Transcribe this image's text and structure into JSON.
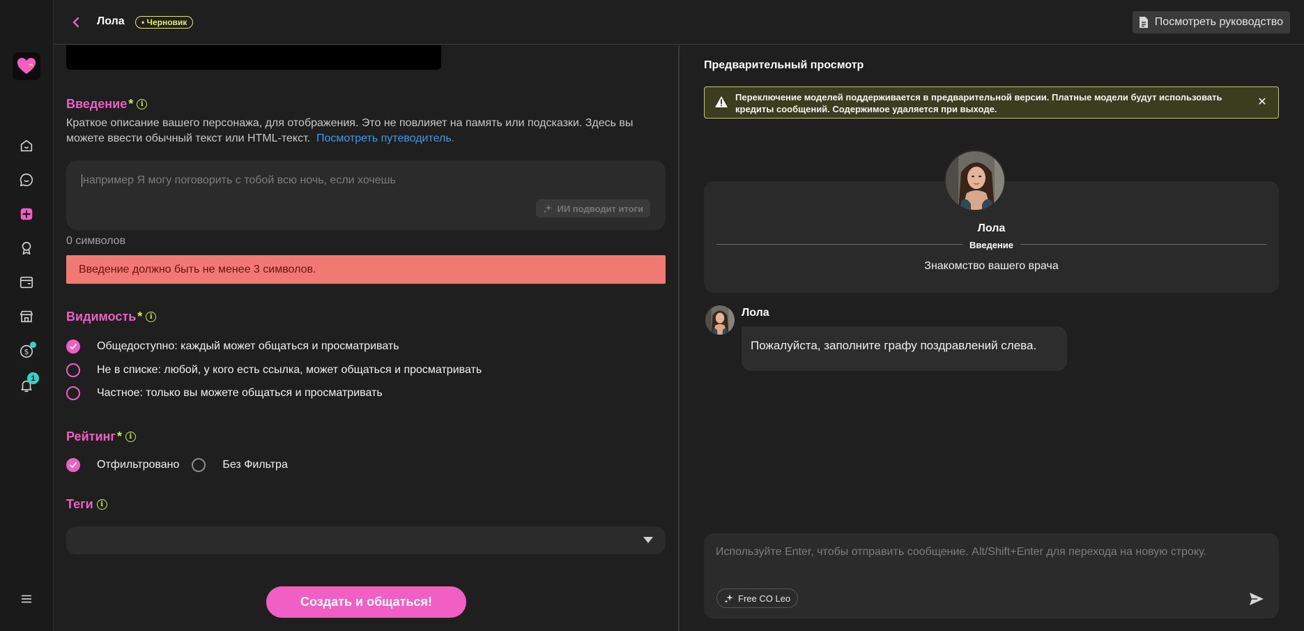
{
  "header": {
    "title": "Лола",
    "draft_badge": "• Черновик",
    "guide_button": "Посмотреть руководство"
  },
  "nav": {
    "notification_count": "1"
  },
  "form": {
    "intro": {
      "title": "Введение",
      "required_mark": "*",
      "description": "Краткое описание вашего персонажа, для отображения. Это не повлияет на память или подсказки. Здесь вы можете ввести обычный текст или HTML-текст.",
      "guide_link": "Посмотреть путеводитель.",
      "placeholder": "например Я могу поговорить с тобой всю ночь, если хочешь",
      "value": "",
      "ai_button": "ИИ подводит итоги",
      "char_count": "0 символов",
      "error": "Введение должно быть не менее 3 символов."
    },
    "visibility": {
      "title": "Видимость",
      "required_mark": "*",
      "options": [
        {
          "label": "Общедоступно: каждый может общаться и просматривать",
          "checked": true
        },
        {
          "label": "Не в списке: любой, у кого есть ссылка, может общаться и просматривать",
          "checked": false
        },
        {
          "label": "Частное: только вы можете общаться и просматривать",
          "checked": false
        }
      ]
    },
    "rating": {
      "title": "Рейтинг",
      "required_mark": "*",
      "options": [
        {
          "label": "Отфильтровано",
          "checked": true
        },
        {
          "label": "Без Фильтра",
          "checked": false
        }
      ]
    },
    "tags": {
      "title": "Теги"
    },
    "submit_button": "Создать и общаться!"
  },
  "preview": {
    "title": "Предварительный просмотр",
    "warning": "Переключение моделей поддерживается в предварительной версии. Платные модели будут использовать кредиты сообщений. Содержимое удаляется при выходе.",
    "card": {
      "name": "Лола",
      "section_label": "Введение",
      "intro_text": "Знакомство вашего врача"
    },
    "message": {
      "author": "Лола",
      "text": "Пожалуйста, заполните графу поздравлений слева."
    },
    "composer": {
      "placeholder": "Используйте Enter, чтобы отправить сообщение. Alt/Shift+Enter для перехода на новую строку.",
      "model_chip": "Free CO Leo"
    }
  },
  "colors": {
    "accent_pink": "#ec5fc3",
    "required_green": "#c6ef4a",
    "error_bg": "#f07a73",
    "badge_teal": "#2fd6c5",
    "link_blue": "#3d9be9"
  }
}
